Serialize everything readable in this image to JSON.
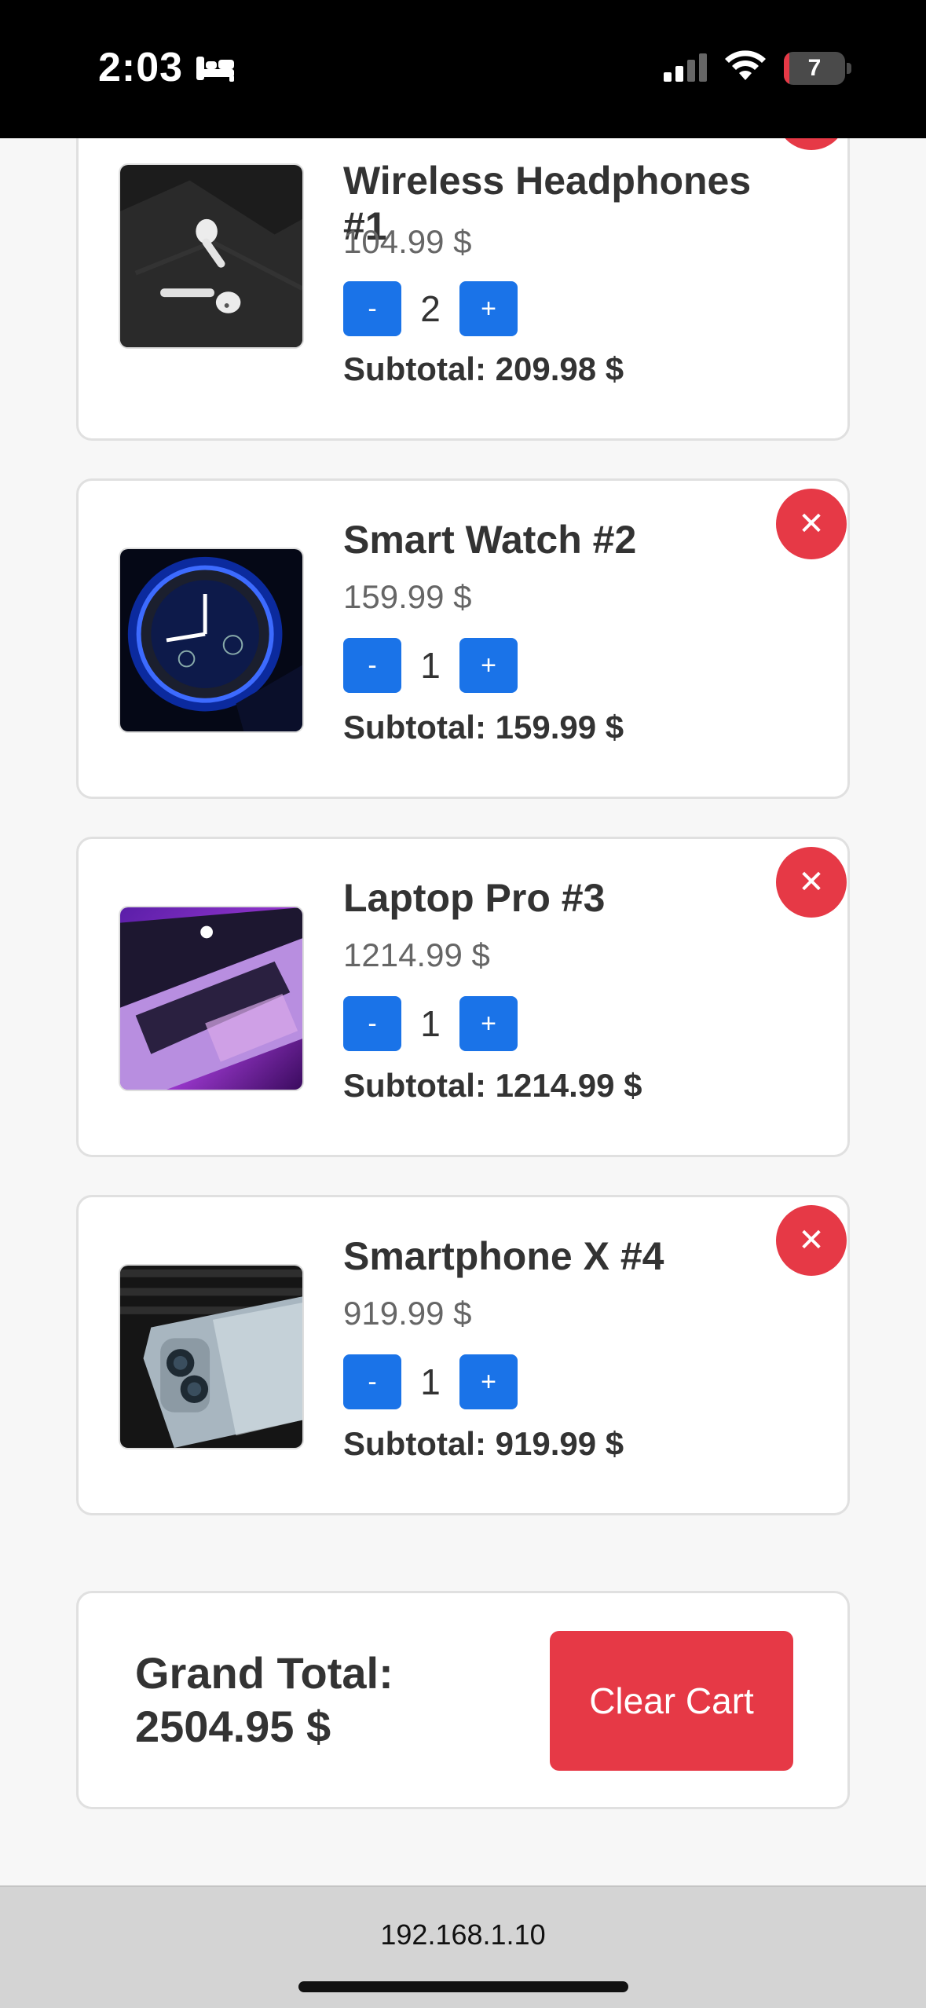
{
  "status_bar": {
    "time": "2:03",
    "battery_level": "7",
    "icons": [
      "bed-icon",
      "cellular-signal-icon",
      "wifi-icon",
      "battery-icon"
    ]
  },
  "cart": {
    "items": [
      {
        "name": "Wireless Headphones #1",
        "price": "104.99 $",
        "quantity": "2",
        "subtotal": "Subtotal: 209.98 $",
        "image": "earbuds-image"
      },
      {
        "name": "Smart Watch #2",
        "price": "159.99 $",
        "quantity": "1",
        "subtotal": "Subtotal: 159.99 $",
        "image": "smartwatch-image"
      },
      {
        "name": "Laptop Pro #3",
        "price": "1214.99 $",
        "quantity": "1",
        "subtotal": "Subtotal: 1214.99 $",
        "image": "laptop-image"
      },
      {
        "name": "Smartphone X #4",
        "price": "919.99 $",
        "quantity": "1",
        "subtotal": "Subtotal: 919.99 $",
        "image": "smartphone-image"
      }
    ],
    "minus_label": "-",
    "plus_label": "+",
    "remove_label": "✕"
  },
  "summary": {
    "grand_total_label": "Grand Total: 2504.95 $",
    "clear_cart_label": "Clear Cart"
  },
  "browser": {
    "url": "192.168.1.10"
  },
  "colors": {
    "accent_blue": "#1a73e8",
    "danger_red": "#e63946"
  }
}
